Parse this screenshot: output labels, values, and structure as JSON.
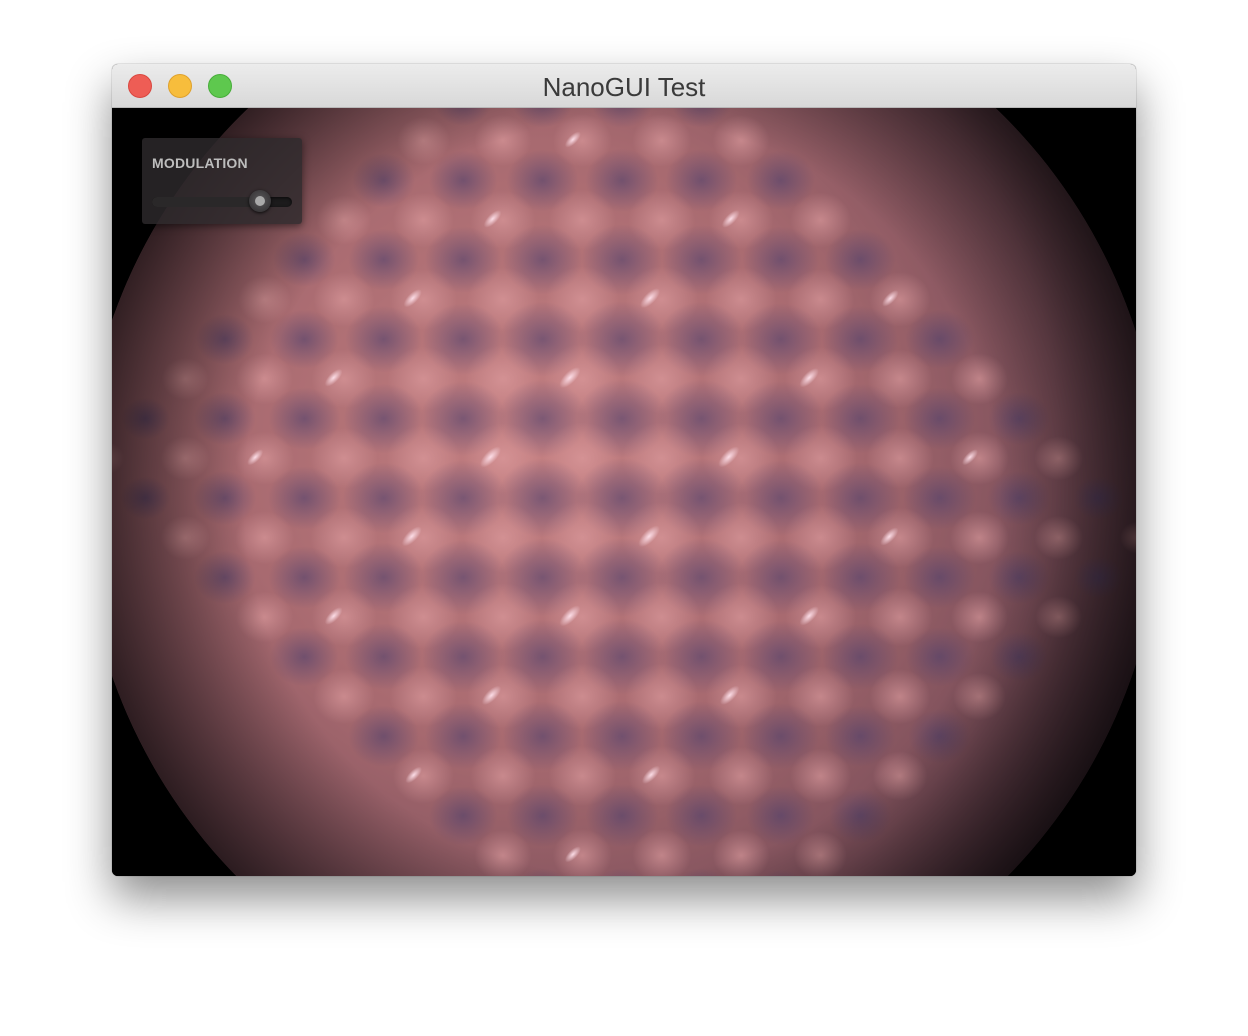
{
  "window": {
    "title": "NanoGUI Test"
  },
  "titlebar": {
    "buttons": [
      {
        "name": "close",
        "color": "#ee5d55"
      },
      {
        "name": "minimize",
        "color": "#f7bd3c"
      },
      {
        "name": "zoom",
        "color": "#5ec84e"
      }
    ]
  },
  "panel": {
    "label": "MODULATION",
    "slider": {
      "value": 0.77
    }
  },
  "scene": {
    "object_color": "#a9666c",
    "shadow_color": "#4f3f6a",
    "background_color": "#000000"
  }
}
